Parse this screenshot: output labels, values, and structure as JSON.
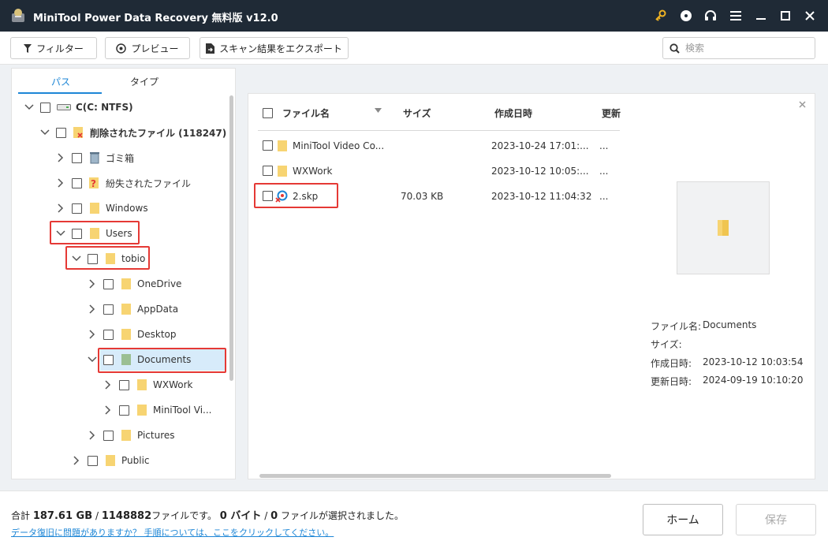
{
  "window": {
    "title": "MiniTool Power Data Recovery 無料版 v12.0"
  },
  "toolbar": {
    "filter_label": "フィルター",
    "preview_label": "プレビュー",
    "export_label": "スキャン結果をエクスポート",
    "search_placeholder": "検索"
  },
  "left_tabs": {
    "path_label": "パス",
    "type_label": "タイプ",
    "active": "パス"
  },
  "tree": [
    {
      "label": "C(C: NTFS)",
      "expanded": true,
      "bold": true
    },
    {
      "label": "削除されたファイル (118247)",
      "expanded": true,
      "bold": true
    },
    {
      "label": "ゴミ箱",
      "expanded": false
    },
    {
      "label": "紛失されたファイル",
      "expanded": false
    },
    {
      "label": "Windows",
      "expanded": false
    },
    {
      "label": "Users",
      "expanded": true
    },
    {
      "label": "tobio",
      "expanded": true
    },
    {
      "label": "OneDrive",
      "expanded": false
    },
    {
      "label": "AppData",
      "expanded": false
    },
    {
      "label": "Desktop",
      "expanded": false
    },
    {
      "label": "Documents",
      "expanded": true,
      "selected": true
    },
    {
      "label": "WXWork",
      "expanded": false
    },
    {
      "label": "MiniTool Vi...",
      "expanded": false
    },
    {
      "label": "Pictures",
      "expanded": false
    },
    {
      "label": "Public",
      "expanded": false
    }
  ],
  "file_list": {
    "columns": [
      "ファイル名",
      "サイズ",
      "作成日時",
      "更新"
    ],
    "rows": [
      {
        "name": "MiniTool Video Co...",
        "size": "",
        "created": "2023-10-24 17:01:...",
        "modified": "..."
      },
      {
        "name": "WXWork",
        "size": "",
        "created": "2023-10-12 10:05:...",
        "modified": "..."
      },
      {
        "name": "2.skp",
        "size": "70.03 KB",
        "created": "2023-10-12 11:04:32",
        "modified": "..."
      }
    ]
  },
  "preview": {
    "labels": {
      "name": "ファイル名:",
      "size": "サイズ:",
      "created": "作成日時:",
      "modified": "更新日時:"
    },
    "values": {
      "name": "Documents",
      "size": "",
      "created": "2023-10-12 10:03:54",
      "modified": "2024-09-19 10:10:20"
    }
  },
  "footer": {
    "summary_prefix": "合計",
    "total_size": "187.61 GB",
    "slash": "/",
    "file_count": "1148882",
    "summary_mid": "ファイルです。",
    "selected_bytes": "0 バイト",
    "selected_files": "0",
    "summary_end": "ファイルが選択されました。",
    "help_text": "データ復旧に問題がありますか？ 手順については、ここをクリックしてください。",
    "home_label": "ホーム",
    "save_label": "保存"
  },
  "colors": {
    "titlebar": "#1f2a36",
    "accent": "#1d86d6",
    "highlight": "#e53935",
    "folder": "#f7d472",
    "selected_row": "#d7ebfa"
  }
}
